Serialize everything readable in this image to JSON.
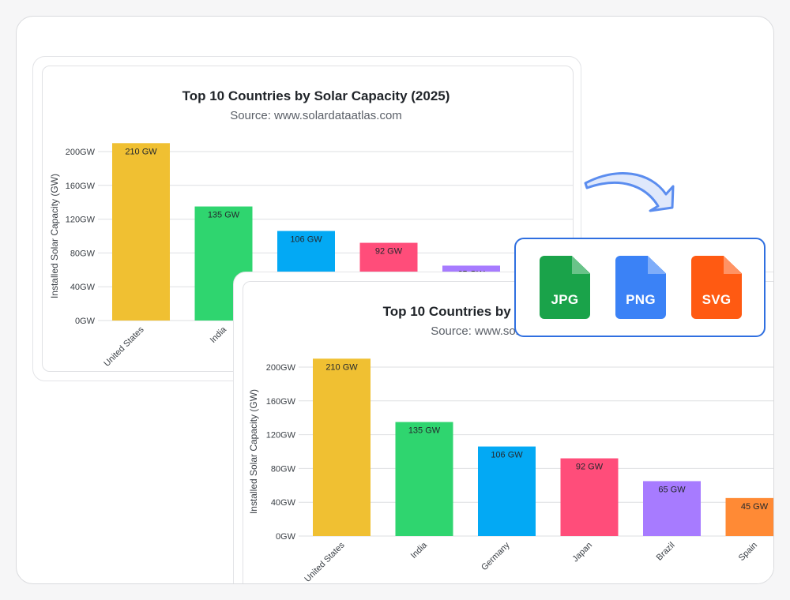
{
  "export_options": {
    "formats": [
      {
        "label": "JPG",
        "color": "#1aa34a"
      },
      {
        "label": "PNG",
        "color": "#3b82f6"
      },
      {
        "label": "SVG",
        "color": "#ff5a12"
      }
    ],
    "arrow_color": "#5b8def",
    "arrow_fill": "#dfe8fb"
  },
  "chart_data": [
    {
      "type": "bar",
      "title": "Top 10 Countries by Solar Capacity (2025)",
      "subtitle": "Source: www.solardataatlas.com",
      "ylabel": "Installed Solar Capacity (GW)",
      "xlabel": "",
      "ylim": [
        0,
        200
      ],
      "yticks": [
        "0GW",
        "40GW",
        "80GW",
        "120GW",
        "160GW",
        "200GW"
      ],
      "grid": true,
      "categories": [
        "United States",
        "India",
        "Germany",
        "Japan",
        "Brazil",
        "Spain"
      ],
      "values": [
        210,
        135,
        106,
        92,
        65,
        45
      ],
      "data_labels": [
        "210 GW",
        "135 GW",
        "106 GW",
        "92 GW",
        "65 GW",
        "45 GW"
      ],
      "colors": [
        "#f0c032",
        "#2fd56f",
        "#03a9f4",
        "#ff4d7a",
        "#a77bff",
        "#ff8a35"
      ]
    },
    {
      "type": "bar",
      "title": "Top 10 Countries by Solar Capacity (2025)",
      "subtitle": "Source: www.solardataatlas.com",
      "ylabel": "Installed Solar Capacity (GW)",
      "xlabel": "",
      "ylim": [
        0,
        200
      ],
      "yticks": [
        "0GW",
        "40GW",
        "80GW",
        "120GW",
        "160GW",
        "200GW"
      ],
      "grid": true,
      "categories": [
        "United States",
        "India",
        "Germany",
        "Japan",
        "Brazil",
        "Spain"
      ],
      "values": [
        210,
        135,
        106,
        92,
        65,
        45
      ],
      "data_labels": [
        "210 GW",
        "135 GW",
        "106 GW",
        "92 GW",
        "65 GW",
        "45 GW"
      ],
      "colors": [
        "#f0c032",
        "#2fd56f",
        "#03a9f4",
        "#ff4d7a",
        "#a77bff",
        "#ff8a35"
      ]
    }
  ]
}
